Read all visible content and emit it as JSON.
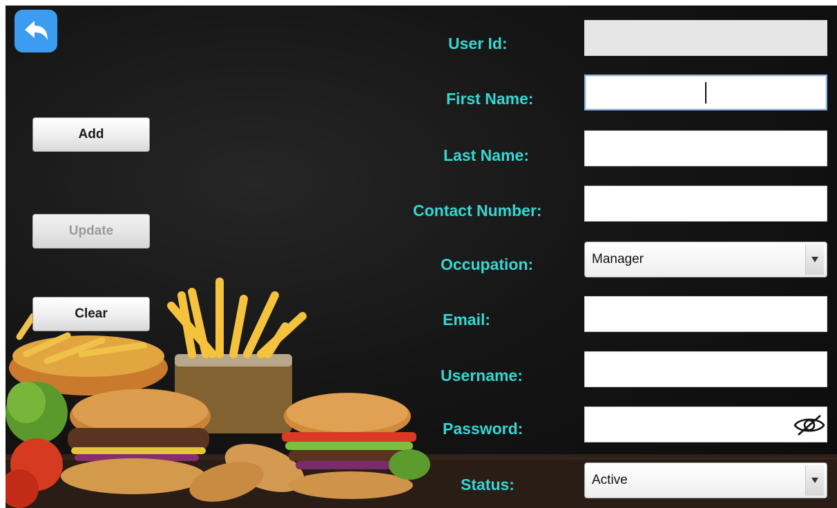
{
  "side_buttons": {
    "add_label": "Add",
    "update_label": "Update",
    "clear_label": "Clear"
  },
  "form": {
    "user_id": {
      "label": "User Id:",
      "value": ""
    },
    "first_name": {
      "label": "First Name:",
      "value": ""
    },
    "last_name": {
      "label": "Last Name:",
      "value": ""
    },
    "contact_number": {
      "label": "Contact Number:",
      "value": ""
    },
    "occupation": {
      "label": "Occupation:",
      "selected": "Manager"
    },
    "email": {
      "label": "Email:",
      "value": ""
    },
    "username": {
      "label": "Username:",
      "value": ""
    },
    "password": {
      "label": "Password:",
      "value": ""
    },
    "status": {
      "label": "Status:",
      "selected": "Active"
    }
  },
  "icons": {
    "back": "back-arrow-icon",
    "password_toggle": "eye-slash-icon",
    "dropdown": "triangle-down-icon"
  },
  "colors": {
    "label": "#33d7d4",
    "back_button": "#3b9cf0",
    "background": "#111111"
  }
}
